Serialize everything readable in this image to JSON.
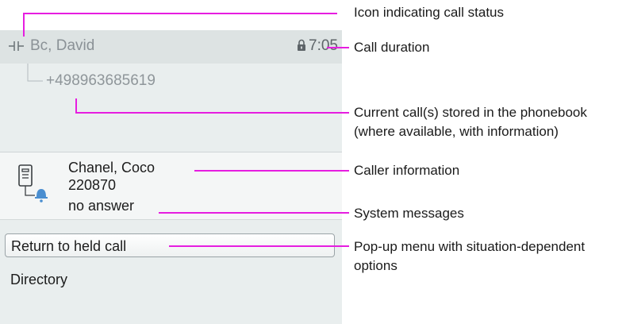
{
  "phone": {
    "held_call": {
      "status_icon": "held-call-icon",
      "name": "Bc, David",
      "lock_icon": "lock-icon",
      "duration": "7:05",
      "number": "+498963685619"
    },
    "active_call": {
      "caller_icon": "phone-ringing-icon",
      "name": "Chanel, Coco",
      "number": "220870",
      "system_message": "no answer"
    },
    "menu": {
      "selected_item": "Return to held call",
      "items": [
        "Return to held call",
        "Directory"
      ]
    }
  },
  "annotations": {
    "call_status": "Icon indicating call status",
    "call_duration": "Call duration",
    "phonebook_line1": "Current call(s) stored in the phonebook",
    "phonebook_line2": "(where available, with information)",
    "caller_info": "Caller information",
    "system_messages": "System messages",
    "popup_line1": "Pop-up menu with situation-dependent",
    "popup_line2": "options"
  },
  "colors": {
    "callout": "#e61de0",
    "screen_bg": "#e9eeee",
    "header_bg": "#dde3e3"
  }
}
